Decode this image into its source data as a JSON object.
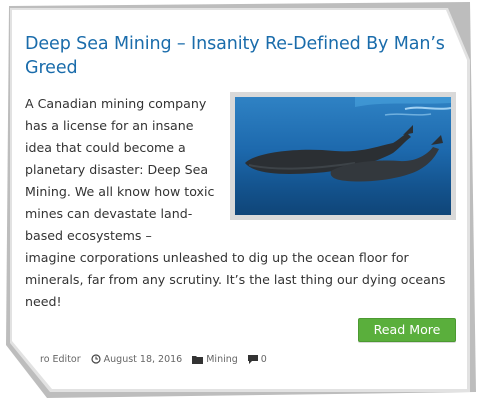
{
  "post": {
    "title": "Deep Sea Mining – Insanity Re-Defined By Man’s Greed",
    "excerpt_wrapped": "A Canadian mining company has a license for an insane idea that could become a planetary disaster: Deep Sea Mining. We all know how toxic mines can devastate land-based ecosystems –",
    "excerpt_full": "imagine corporations unleashed to dig up the ocean floor for minerals, far from any scrutiny. It’s the last thing our dying oceans need!",
    "read_more_label": "Read More",
    "image_icon": "sperm-whales-photo"
  },
  "meta": {
    "author": "ro Editor",
    "date": "August 18, 2016",
    "category": "Mining",
    "comments": "0",
    "icons": [
      "clock-icon",
      "folder-icon",
      "comment-icon"
    ]
  },
  "colors": {
    "title": "#1a6cab",
    "button": "#5aaf3c",
    "text": "#333333"
  }
}
